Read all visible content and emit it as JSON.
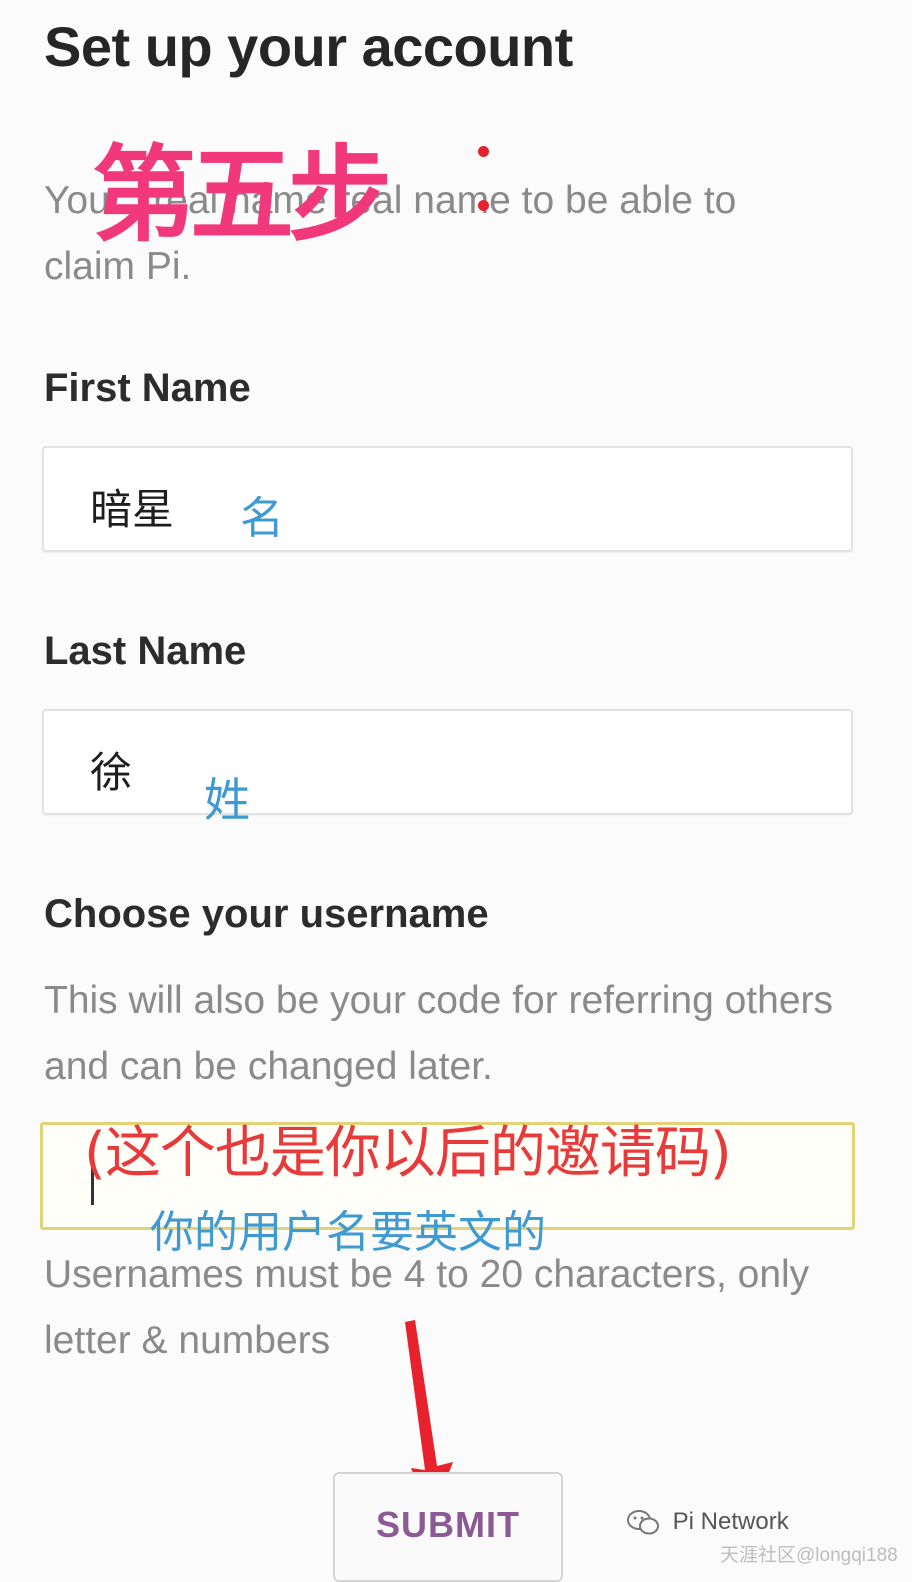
{
  "page": {
    "title": "Set up your account",
    "intro": "You... real name real name to be able to claim Pi."
  },
  "annotations": {
    "step": "第五步",
    "first_name_note": "名",
    "last_name_note": "姓",
    "invite_note": "(这个也是你以后的邀请码)",
    "username_note": "你的用户名要英文的"
  },
  "form": {
    "first_name": {
      "label": "First Name",
      "value": "暗星"
    },
    "last_name": {
      "label": "Last Name",
      "value": "徐"
    },
    "username": {
      "label": "Choose your username",
      "helper": "This will also be your code for referring others and can be changed later.",
      "value": "",
      "rule": "Usernames must be 4 to 20 characters, only letter & numbers"
    },
    "submit_label": "SUBMIT"
  },
  "watermark": {
    "account": "Pi Network",
    "credit": "天涯社区@longqi188"
  },
  "colors": {
    "annotation_pink": "#f0387a",
    "annotation_red": "#e83a3a",
    "annotation_blue": "#3f9ad1",
    "submit_text": "#8b5a95",
    "focus_border": "#e3d376"
  },
  "icons": [
    "red-arrow-icon",
    "wechat-icon"
  ]
}
